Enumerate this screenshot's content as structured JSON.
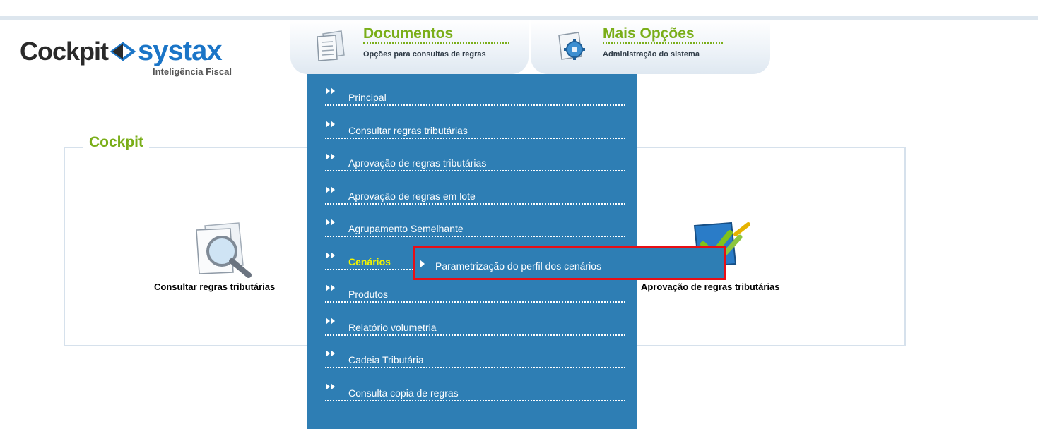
{
  "brand": {
    "cockpit": "Cockpit",
    "systax": "systax",
    "tagline": "Inteligência Fiscal"
  },
  "tabs": [
    {
      "title": "Documentos",
      "subtitle": "Opções para consultas de regras",
      "icon": "documents-icon"
    },
    {
      "title": "Mais Opções",
      "subtitle": "Administração do sistema",
      "icon": "gear-icon"
    }
  ],
  "cockpit": {
    "legend": "Cockpit",
    "items": [
      {
        "label": "Consultar regras tributárias",
        "icon": "magnifier-icon"
      },
      {
        "label": "Aprovação de regras tributárias",
        "icon": "approval-icon"
      }
    ]
  },
  "menu": {
    "items": [
      {
        "label": "Principal"
      },
      {
        "label": "Consultar regras tributárias"
      },
      {
        "label": "Aprovação de regras tributárias"
      },
      {
        "label": "Aprovação de regras em lote"
      },
      {
        "label": "Agrupamento Semelhante"
      },
      {
        "label": "Cenários"
      },
      {
        "label": "Produtos"
      },
      {
        "label": "Relatório volumetria"
      },
      {
        "label": "Cadeia Tributária"
      },
      {
        "label": "Consulta copia de regras"
      }
    ],
    "active_index": 5,
    "submenu": {
      "label": "Parametrização do perfil dos cenários"
    }
  },
  "colors": {
    "accent_green": "#7aae19",
    "menu_blue": "#2e7eb4",
    "highlight_yellow": "#f4f500",
    "highlight_red": "#e80e15",
    "brand_blue": "#1b75c7"
  }
}
